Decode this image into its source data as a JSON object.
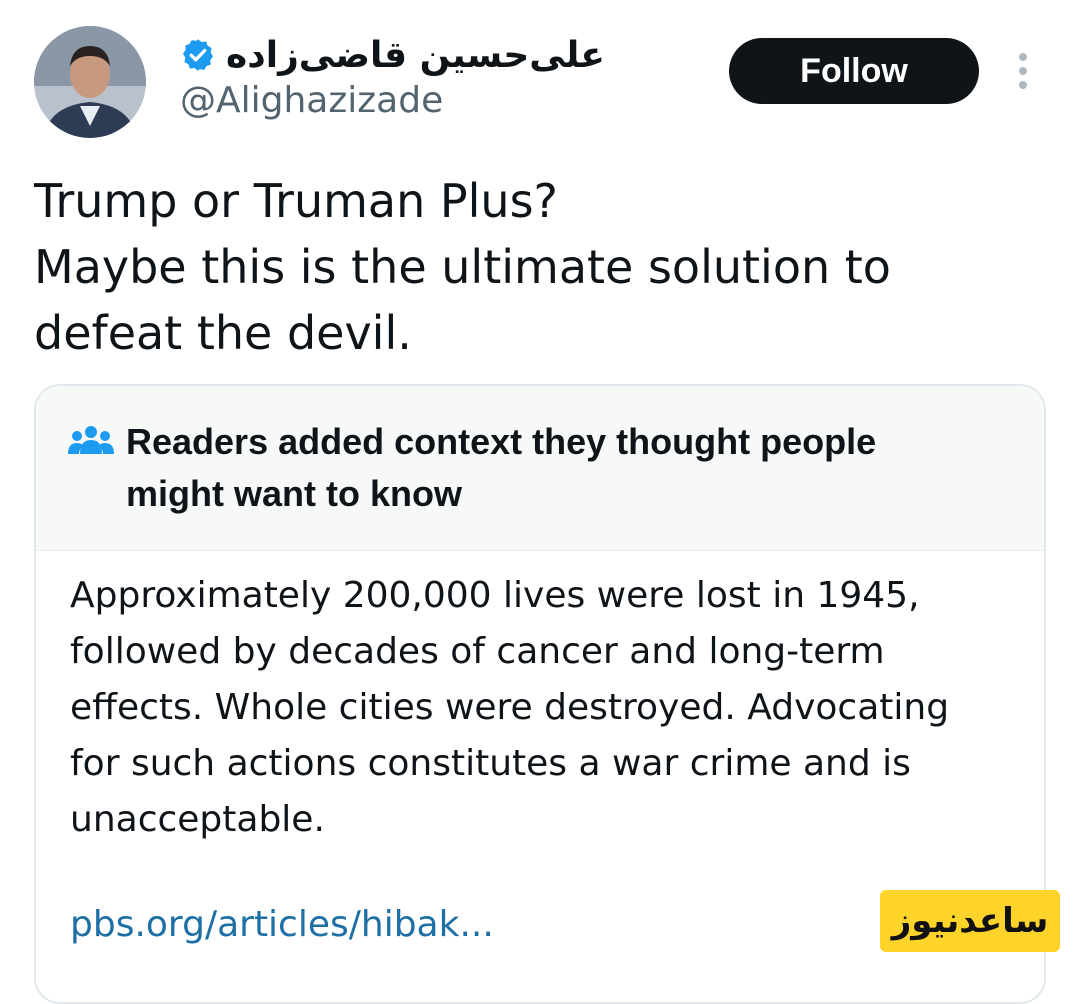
{
  "header": {
    "display_name": "علی‌حسین قاضی‌زاده",
    "handle": "@Alighazizade",
    "follow_label": "Follow",
    "verified_color": "#1d9bf0"
  },
  "tweet": {
    "lines": [
      "Trump or Truman Plus?",
      "Maybe this is the ultimate solution to",
      "defeat the devil."
    ]
  },
  "community_note": {
    "title_lines": [
      "Readers added context they thought people",
      "might want to know"
    ],
    "body_lines": [
      "Approximately 200,000 lives were lost in 1945,",
      "followed by decades of cancer and long-term",
      "effects. Whole cities were destroyed. Advocating",
      "for such actions constitutes a war crime and is",
      "unacceptable."
    ],
    "link_text": "pbs.org/articles/hibak...",
    "icon_color": "#1d9bf0",
    "link_color": "#1d6fa5"
  },
  "watermark": {
    "text": "ساعدنیوز",
    "color": "#ffd42a"
  }
}
